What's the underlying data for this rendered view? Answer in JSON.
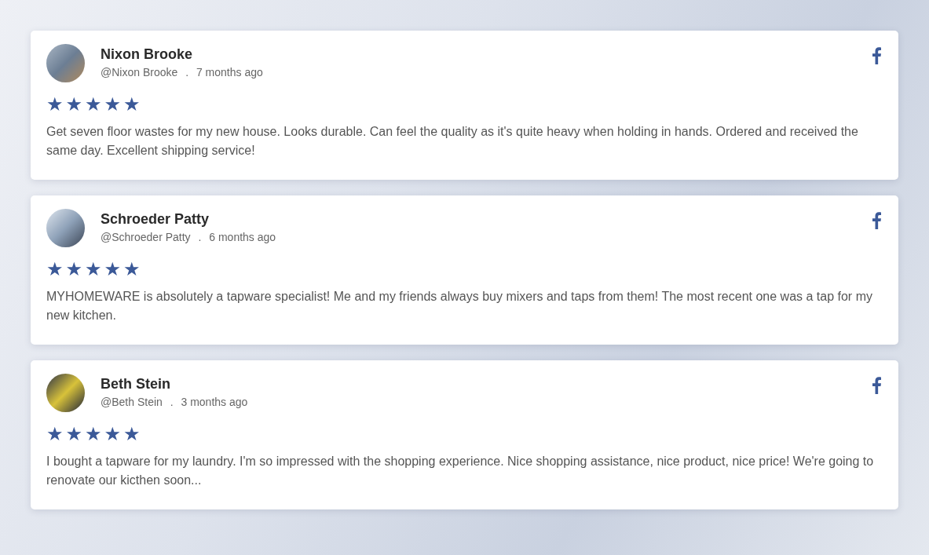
{
  "reviews": [
    {
      "name": "Nixon Brooke",
      "handle": "@Nixon Brooke",
      "separator": ".",
      "time": "7 months ago",
      "stars": 5,
      "text": "Get seven floor wastes for my new house. Looks durable. Can feel the quality as it's quite heavy when holding in hands. Ordered and received the same day. Excellent shipping service!"
    },
    {
      "name": "Schroeder Patty",
      "handle": "@Schroeder Patty",
      "separator": ".",
      "time": "6 months ago",
      "stars": 5,
      "text": "MYHOMEWARE is absolutely a tapware specialist! Me and my friends always buy mixers and taps from them! The most recent one was a tap for my new kitchen."
    },
    {
      "name": "Beth Stein",
      "handle": "@Beth Stein",
      "separator": ".",
      "time": "3 months ago",
      "stars": 5,
      "text": "I bought a tapware for my laundry. I'm so impressed with the shopping experience. Nice shopping assistance, nice product, nice price! We're going to renovate our kicthen soon..."
    }
  ]
}
